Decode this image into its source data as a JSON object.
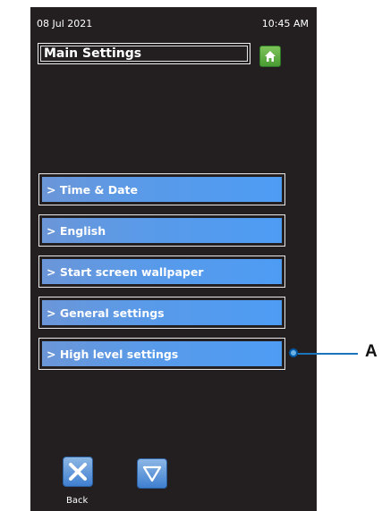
{
  "status": {
    "date": "08 Jul 2021",
    "time": "10:45 AM"
  },
  "header": {
    "title": "Main Settings"
  },
  "menu": {
    "items": [
      {
        "label": "> Time & Date"
      },
      {
        "label": "> English"
      },
      {
        "label": "> Start screen wallpaper"
      },
      {
        "label": "> General settings"
      },
      {
        "label": "> High level settings"
      }
    ]
  },
  "callout": {
    "letter": "A"
  },
  "footer": {
    "back_label": "Back"
  },
  "icons": {
    "home": "home-icon",
    "back": "close-x-icon",
    "down": "triangle-down-icon"
  },
  "colors": {
    "screen_bg": "#231f20",
    "menu_blue": "#4d9cf4",
    "home_green": "#5aae3f",
    "callout_blue": "#1b75bb"
  }
}
